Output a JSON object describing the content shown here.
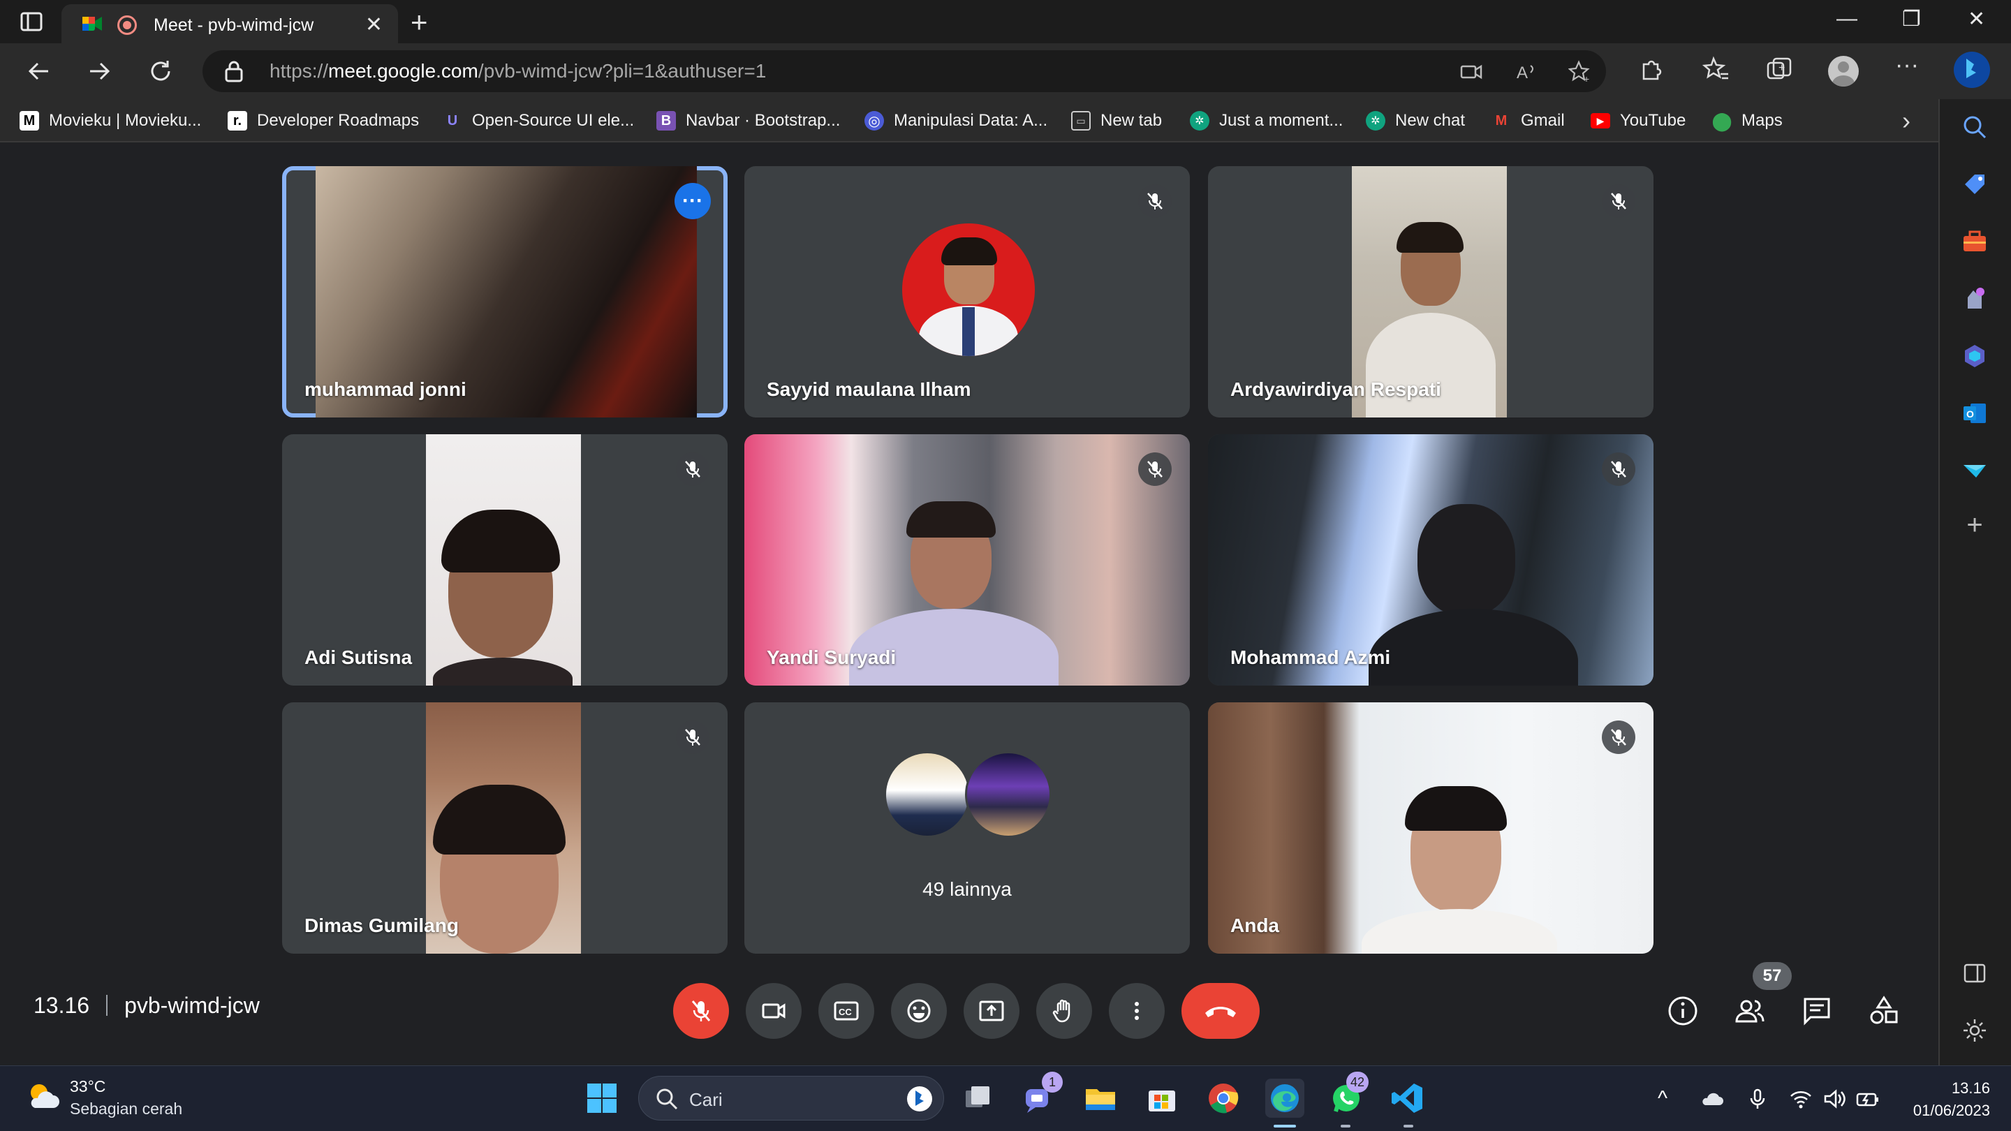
{
  "browser": {
    "tab_title": "Meet - pvb-wimd-jcw",
    "url_prefix": "https://",
    "url_host": "meet.google.com",
    "url_path": "/pvb-wimd-jcw?pli=1&authuser=1",
    "bookmarks": [
      {
        "label": "Movieku | Movieku...",
        "icon": "movieku-icon",
        "color": "#ffffff"
      },
      {
        "label": "Developer Roadmaps",
        "icon": "roadmap-icon",
        "color": "#ffffff"
      },
      {
        "label": "Open-Source UI ele...",
        "icon": "ui-icon",
        "color": "#6c63ff"
      },
      {
        "label": "Navbar · Bootstrap...",
        "icon": "bootstrap-icon",
        "color": "#7952b3"
      },
      {
        "label": "Manipulasi Data: A...",
        "icon": "globe-icon",
        "color": "#4b5bd6"
      },
      {
        "label": "New tab",
        "icon": "newtab-icon",
        "color": "#cccccc"
      },
      {
        "label": "Just a moment...",
        "icon": "chatgpt-icon",
        "color": "#10a37f"
      },
      {
        "label": "New chat",
        "icon": "chatgpt-icon",
        "color": "#10a37f"
      },
      {
        "label": "Gmail",
        "icon": "gmail-icon",
        "color": "#ea4335"
      },
      {
        "label": "YouTube",
        "icon": "youtube-icon",
        "color": "#ff0000"
      },
      {
        "label": "Maps",
        "icon": "maps-icon",
        "color": "#34a853"
      }
    ]
  },
  "meet": {
    "participants": [
      {
        "name": "muhammad jonni",
        "muted": false,
        "active": true
      },
      {
        "name": "Sayyid maulana Ilham",
        "muted": true,
        "active": false
      },
      {
        "name": "Ardyawirdiyan Respati",
        "muted": true,
        "active": false
      },
      {
        "name": "Adi Sutisna",
        "muted": true,
        "active": false
      },
      {
        "name": "Yandi Suryadi",
        "muted": true,
        "active": false
      },
      {
        "name": "Mohammad Azmi",
        "muted": true,
        "active": false
      },
      {
        "name": "Dimas Gumilang",
        "muted": true,
        "active": false
      },
      {
        "name": "Anda",
        "muted": true,
        "active": false
      }
    ],
    "others_label": "49 lainnya",
    "time": "13.16",
    "meeting_code": "pvb-wimd-jcw",
    "people_count": "57"
  },
  "taskbar": {
    "temperature": "33°C",
    "weather": "Sebagian cerah",
    "search_placeholder": "Cari",
    "teams_badge": "1",
    "whatsapp_badge": "42",
    "clock_time": "13.16",
    "clock_date": "01/06/2023"
  },
  "colors": {
    "accent": "#8ab4f8",
    "danger": "#ea4335",
    "meet_bg": "#202124",
    "tile_bg": "#3c4043"
  }
}
